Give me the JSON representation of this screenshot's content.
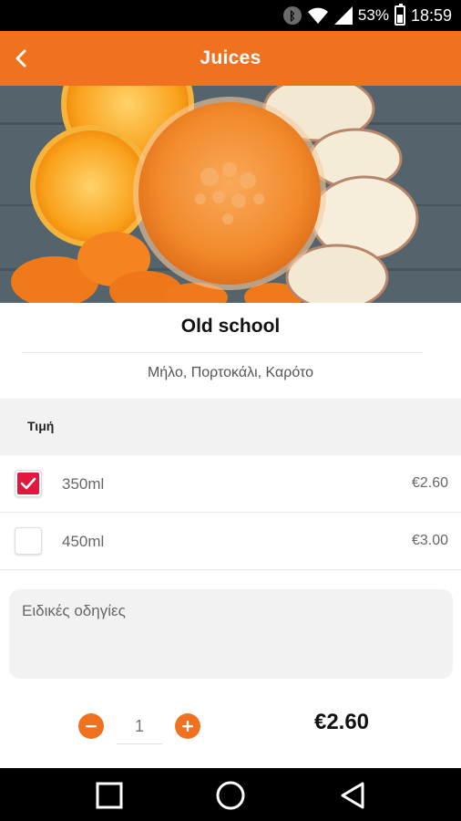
{
  "status_bar": {
    "battery": "53%",
    "time": "18:59",
    "icons": [
      "bluetooth-icon",
      "wifi-icon",
      "signal-icon",
      "battery-icon"
    ]
  },
  "app_bar": {
    "title": "Juices",
    "back_icon": "chevron-left-icon"
  },
  "product": {
    "name": "Old school",
    "ingredients": "Μήλο, Πορτοκάλι, Καρότο"
  },
  "price_section": {
    "title": "Τιμή",
    "options": [
      {
        "label": "350ml",
        "price": "€2.60",
        "checked": true
      },
      {
        "label": "450ml",
        "price": "€3.00",
        "checked": false
      }
    ]
  },
  "notes": {
    "placeholder": "Ειδικές οδηγίες"
  },
  "order": {
    "quantity": "1",
    "total": "€2.60"
  },
  "colors": {
    "accent": "#f07120",
    "checkbox_checked": "#e2173e"
  },
  "nav_bar": {
    "icons": [
      "recents-square-icon",
      "home-circle-icon",
      "back-triangle-icon"
    ]
  }
}
